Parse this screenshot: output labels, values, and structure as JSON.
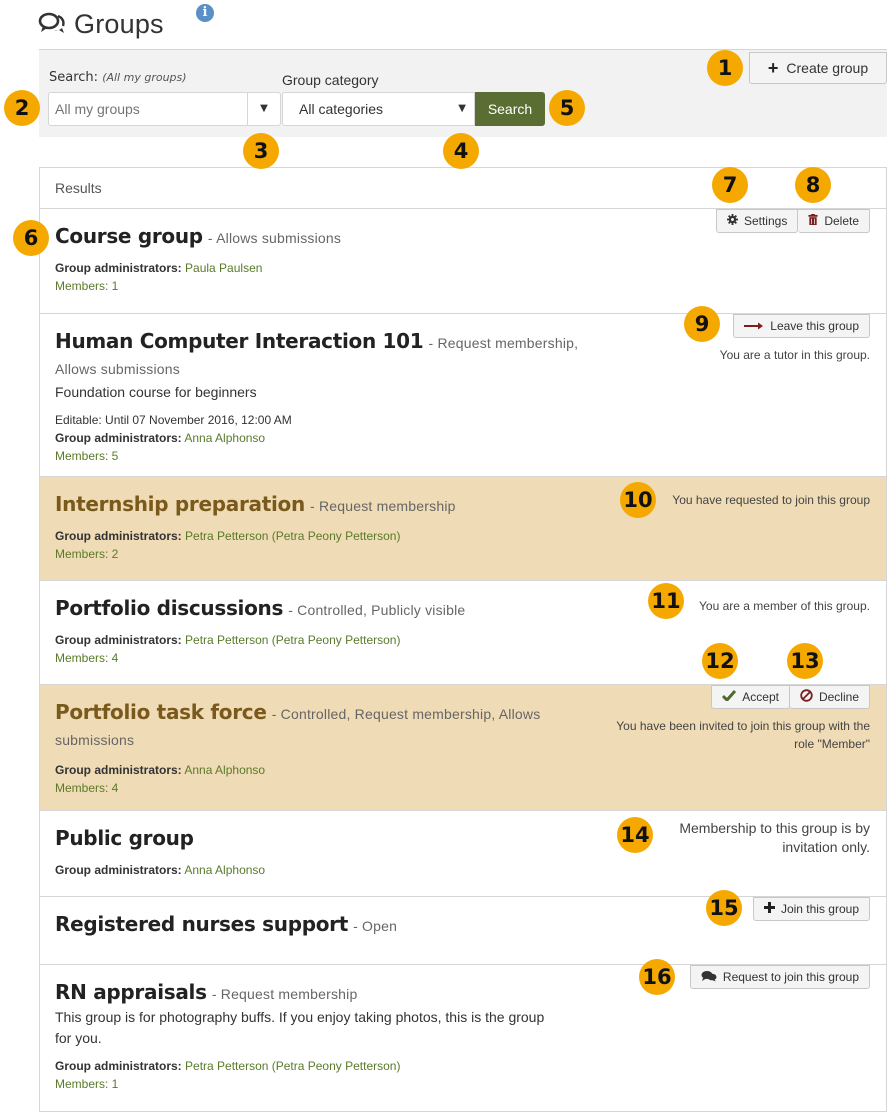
{
  "page": {
    "title": "Groups",
    "title_icon": "chat-bubbles-icon",
    "info_icon": "info-icon"
  },
  "filters": {
    "search_label": "Search:",
    "search_hint": "(All my groups)",
    "search_placeholder": "All my groups",
    "search_value": "",
    "search_dropdown_arrow": "▼",
    "category_label": "Group category",
    "category_value": "All categories",
    "category_dropdown_arrow": "▼",
    "search_button": "Search",
    "create_button": "Create group",
    "create_icon": "+"
  },
  "results": {
    "heading": "Results",
    "groups": [
      {
        "name": "Course group",
        "meta": "- Allows submissions",
        "description": "",
        "editable": "",
        "admins_label": "Group administrators:",
        "admins": "Paula Paulsen",
        "members": "Members: 1",
        "highlight": false,
        "buttons": [
          {
            "label": "Settings",
            "icon": "gear-icon"
          },
          {
            "label": "Delete",
            "icon": "trash-icon"
          }
        ],
        "status": ""
      },
      {
        "name": "Human Computer Interaction 101",
        "meta": "- Request membership, Allows submissions",
        "description": "Foundation course for beginners",
        "editable": "Editable: Until 07 November 2016, 12:00 AM",
        "admins_label": "Group administrators:",
        "admins": "Anna Alphonso",
        "members": "Members: 5",
        "highlight": false,
        "buttons": [
          {
            "label": "Leave this group",
            "icon": "arrow-right-icon"
          }
        ],
        "status": "You are a tutor in this group."
      },
      {
        "name": "Internship preparation",
        "meta": "- Request membership",
        "description": "",
        "editable": "",
        "admins_label": "Group administrators:",
        "admins": "Petra Petterson (Petra Peony Petterson)",
        "members": "Members: 2",
        "highlight": true,
        "buttons": [],
        "status": "You have requested to join this group"
      },
      {
        "name": "Portfolio discussions",
        "meta": "- Controlled, Publicly visible",
        "description": "",
        "editable": "",
        "admins_label": "Group administrators:",
        "admins": "Petra Petterson (Petra Peony Petterson)",
        "members": "Members: 4",
        "highlight": false,
        "buttons": [],
        "status": "You are a member of this group."
      },
      {
        "name": "Portfolio task force",
        "meta": "- Controlled, Request membership, Allows submissions",
        "description": "",
        "editable": "",
        "admins_label": "Group administrators:",
        "admins": "Anna Alphonso",
        "members": "Members: 4",
        "highlight": true,
        "buttons": [
          {
            "label": "Accept",
            "icon": "check-icon"
          },
          {
            "label": "Decline",
            "icon": "ban-icon"
          }
        ],
        "status": "You have been invited to join this group with the role \"Member\""
      },
      {
        "name": "Public group",
        "meta": "",
        "description": "",
        "editable": "",
        "admins_label": "Group administrators:",
        "admins": "Anna Alphonso",
        "members": "",
        "highlight": false,
        "buttons": [],
        "status": "Membership to this group is by invitation only."
      },
      {
        "name": "Registered nurses support",
        "meta": "- Open",
        "description": "",
        "editable": "",
        "admins_label": "",
        "admins": "",
        "members": "",
        "highlight": false,
        "buttons": [
          {
            "label": "Join this group",
            "icon": "plus-icon"
          }
        ],
        "status": ""
      },
      {
        "name": "RN appraisals",
        "meta": "- Request membership",
        "description": "This group is for photography buffs. If you enjoy taking photos, this is the group for you.",
        "editable": "",
        "admins_label": "Group administrators:",
        "admins": "Petra Petterson (Petra Peony Petterson)",
        "members": "Members: 1",
        "highlight": false,
        "buttons": [
          {
            "label": "Request to join this group",
            "icon": "chat-bubbles-icon"
          }
        ],
        "status": ""
      }
    ]
  },
  "callouts": [
    "1",
    "2",
    "3",
    "4",
    "5",
    "6",
    "7",
    "8",
    "9",
    "10",
    "11",
    "12",
    "13",
    "14",
    "15",
    "16"
  ],
  "colors": {
    "accent_green": "#5a6e34",
    "highlight_row": "#efdbb5",
    "callout": "#f5a800",
    "link_green": "#5a7a2a"
  }
}
